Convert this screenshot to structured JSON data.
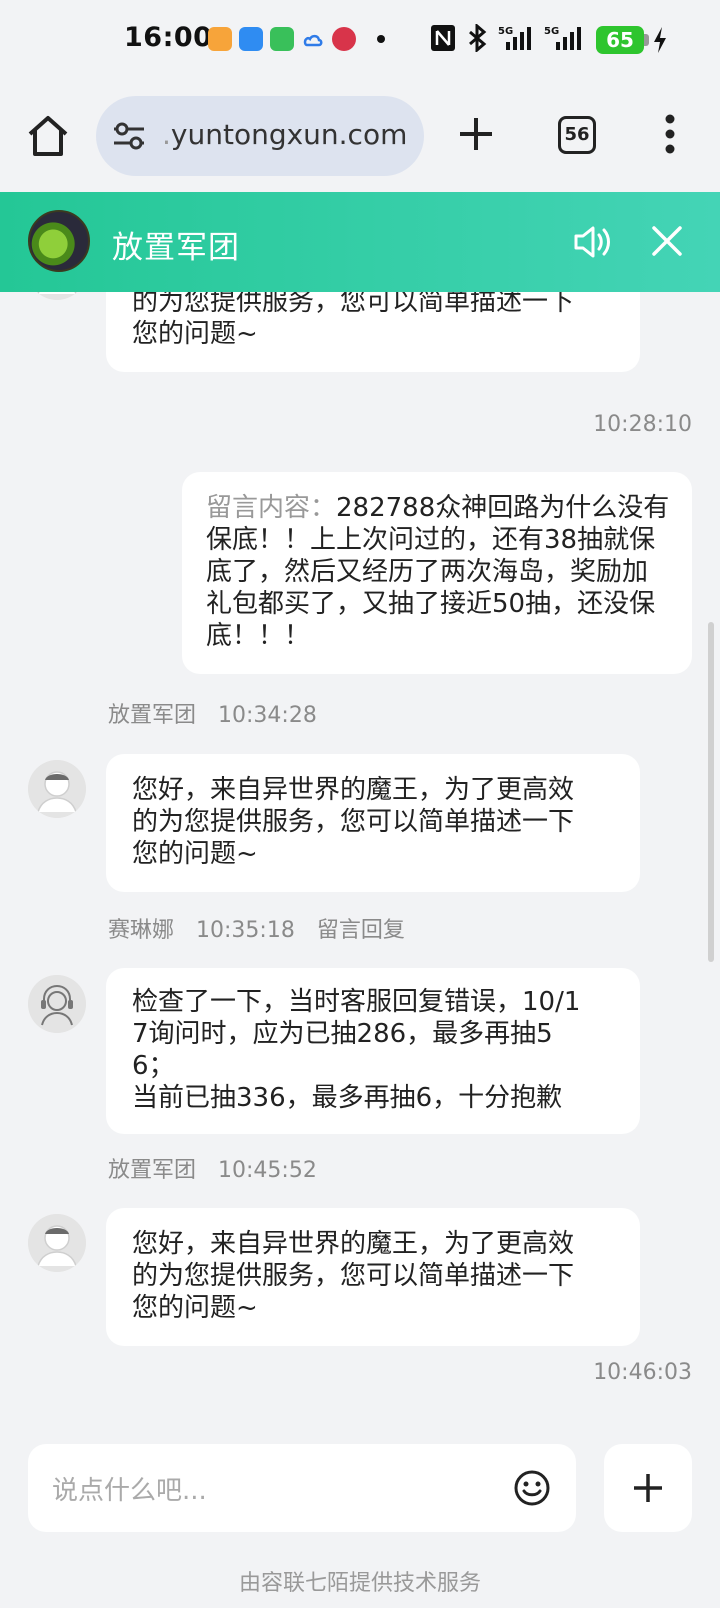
{
  "status_bar": {
    "time": "16:00",
    "battery": "65",
    "signal_1": "5G",
    "signal_2": "5G"
  },
  "browser": {
    "url_prefix": ".",
    "url": "yuntongxun.com",
    "tab_count": "56"
  },
  "chat_header": {
    "title": "放置军团"
  },
  "messages": [
    {
      "type": "agent",
      "text_line1": "的为您提供服务，您可以简单描述一下",
      "text_line2": "您的问题~"
    },
    {
      "type": "user",
      "timestamp": "10:28:10",
      "label": "留言内容：",
      "text": "282788众神回路为什么没有保底！！上上次问过的，还有38抽就保底了，然后又经历了两次海岛，奖励加礼包都买了，又抽了接近50抽，还没保底！！！"
    },
    {
      "type": "agent",
      "sender": "放置军团",
      "time": "10:34:28",
      "text_line1": "您好，来自异世界的魔王，为了更高效",
      "text_line2": "的为您提供服务，您可以简单描述一下",
      "text_line3": "您的问题~"
    },
    {
      "type": "agent",
      "sender": "赛琳娜",
      "time": "10:35:18",
      "tag": "留言回复",
      "text_line1": "检查了一下，当时客服回复错误，10/1",
      "text_line2": "7询问时，应为已抽286，最多再抽5",
      "text_line3": "6；",
      "text_line4": "当前已抽336，最多再抽6，十分抱歉"
    },
    {
      "type": "agent",
      "sender": "放置军团",
      "time": "10:45:52",
      "text_line1": "您好，来自异世界的魔王，为了更高效",
      "text_line2": "的为您提供服务，您可以简单描述一下",
      "text_line3": "您的问题~"
    },
    {
      "type": "timestamp",
      "timestamp": "10:46:03"
    }
  ],
  "input": {
    "placeholder": "说点什么吧..."
  },
  "footer": {
    "text": "由容联七陌提供技术服务"
  }
}
